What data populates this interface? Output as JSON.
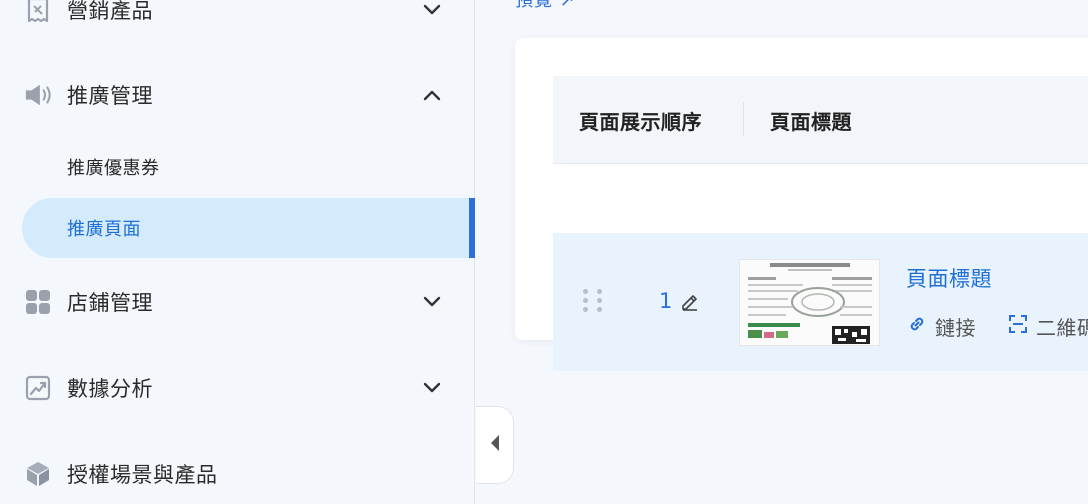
{
  "sidebar": {
    "items": [
      {
        "label": "營銷產品",
        "icon": "receipt-icon",
        "expanded": false
      },
      {
        "label": "推廣管理",
        "icon": "megaphone-icon",
        "expanded": true,
        "children": [
          {
            "label": "推廣優惠券",
            "active": false
          },
          {
            "label": "推廣頁面",
            "active": true
          }
        ]
      },
      {
        "label": "店鋪管理",
        "icon": "grid-apps-icon",
        "expanded": false
      },
      {
        "label": "數據分析",
        "icon": "chart-trend-icon",
        "expanded": false
      },
      {
        "label": "授權場景與產品",
        "icon": "cube-icon",
        "expanded": false
      }
    ]
  },
  "top_link": "預覽 ↗",
  "table": {
    "columns": [
      "頁面展示順序",
      "頁面標題"
    ],
    "rows": [
      {
        "order": "1",
        "title": "頁面標題",
        "link_label": "鏈接",
        "qr_label": "二維碼"
      }
    ]
  },
  "colors": {
    "accent": "#2b6fd8",
    "active_bg": "#d4ebfd",
    "row_bg": "#e9f3fe"
  }
}
